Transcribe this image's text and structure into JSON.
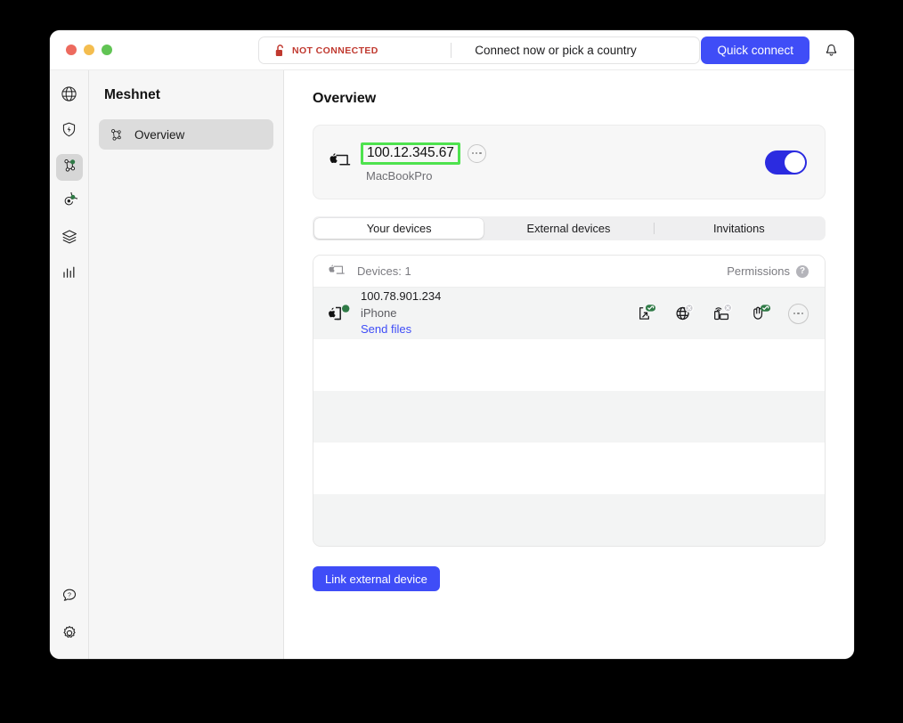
{
  "window": {
    "traffic_lights": [
      "close",
      "minimize",
      "zoom"
    ]
  },
  "titlebar": {
    "connection_status": "NOT CONNECTED",
    "connection_prompt": "Connect now or pick a country",
    "quick_connect_label": "Quick connect",
    "lock_icon": "unlocked-padlock-icon",
    "bell_icon": "notification-bell-icon",
    "status_color": "#c0392f",
    "accent_color": "#3f4df7"
  },
  "rail": {
    "items": [
      {
        "name": "vpn-globe",
        "icon": "globe-icon",
        "active": false,
        "badge": false
      },
      {
        "name": "threat-protection",
        "icon": "shield-bolt-icon",
        "active": false,
        "badge": false
      },
      {
        "name": "meshnet",
        "icon": "meshnet-nodes-icon",
        "active": true,
        "badge": true
      },
      {
        "name": "dark-web-monitor",
        "icon": "radar-icon",
        "active": false,
        "badge": true
      },
      {
        "name": "file-storage",
        "icon": "layers-icon",
        "active": false,
        "badge": false
      },
      {
        "name": "statistics",
        "icon": "bar-chart-icon",
        "active": false,
        "badge": false
      }
    ],
    "bottom_items": [
      {
        "name": "help",
        "icon": "help-bubble-icon"
      },
      {
        "name": "settings",
        "icon": "gear-icon"
      }
    ]
  },
  "nav": {
    "title": "Meshnet",
    "items": [
      {
        "label": "Overview",
        "icon": "meshnet-nodes-icon",
        "active": true
      }
    ]
  },
  "main": {
    "page_title": "Overview",
    "device_card": {
      "icon": "apple-desktop-icon",
      "ip": "100.12.345.67",
      "name": "MacBookPro",
      "more_icon": "ellipsis-icon",
      "toggle_on": true,
      "highlight_color": "#4ee24e"
    },
    "tabs": [
      {
        "label": "Your devices",
        "active": true
      },
      {
        "label": "External devices",
        "active": false
      },
      {
        "label": "Invitations",
        "active": false
      }
    ],
    "list_header": {
      "icon": "apple-desktop-icon",
      "label": "Devices: 1",
      "permissions_label": "Permissions",
      "help_icon": "question-mark-icon",
      "help_glyph": "?"
    },
    "devices": [
      {
        "icon": "apple-phone-icon",
        "status": "online",
        "ip": "100.78.901.234",
        "name": "iPhone",
        "link_label": "Send files",
        "actions": [
          {
            "name": "remote-access-icon",
            "state": "enabled"
          },
          {
            "name": "traffic-routing-globe-icon",
            "state": "disabled"
          },
          {
            "name": "local-network-icon",
            "state": "disabled"
          },
          {
            "name": "file-sharing-icon",
            "state": "enabled"
          },
          {
            "name": "ellipsis-icon",
            "state": "menu"
          }
        ]
      }
    ],
    "empty_rows": 4,
    "link_button_label": "Link external device"
  }
}
